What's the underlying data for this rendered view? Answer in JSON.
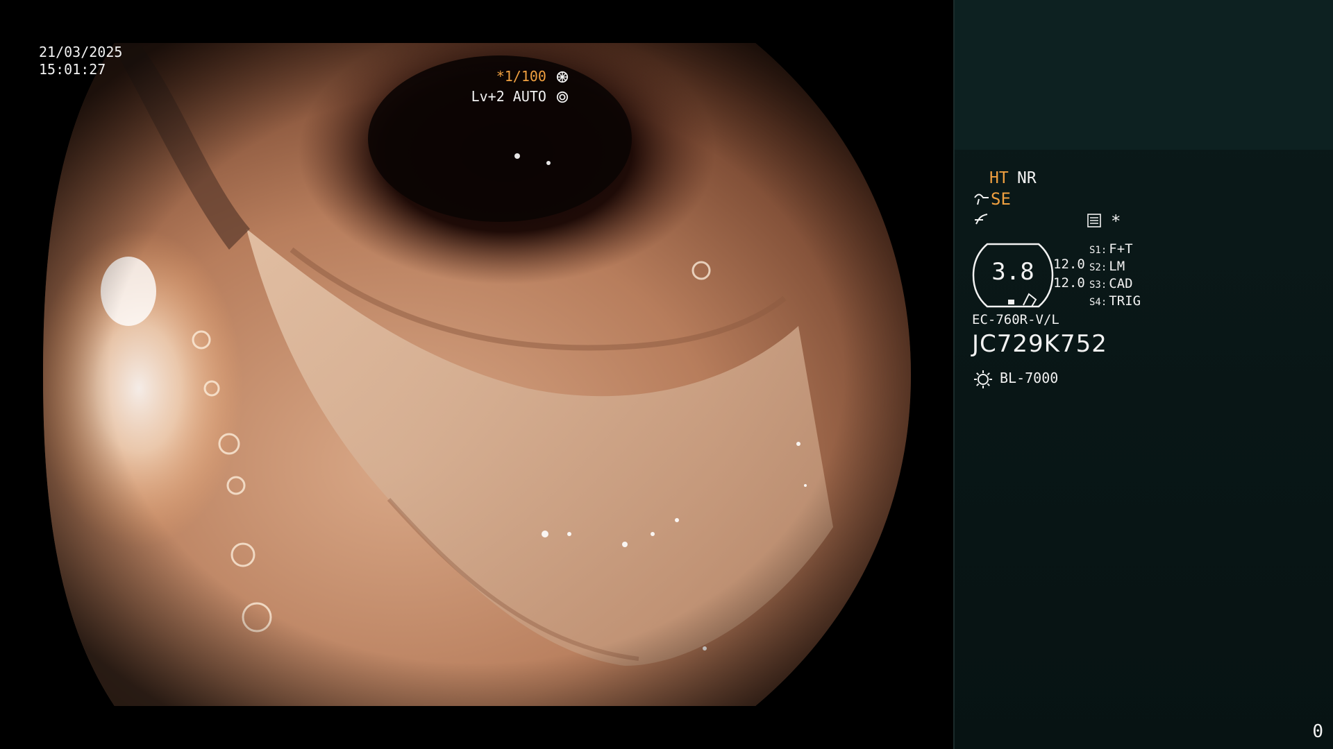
{
  "view": {
    "date": "21/03/2025",
    "time": "15:01:27",
    "shutter": "*1/100",
    "shutter_icon": "shutter-icon",
    "level": "Lv+2 AUTO",
    "level_icon": "auto-iris-icon"
  },
  "panel": {
    "ht": "HT",
    "nr": "NR",
    "se": "SE",
    "se_icon": "structure-enhancement-icon",
    "enh_icon": "contrast-icon",
    "menu_icon": "menu-icon",
    "star": "*",
    "gauge_value": "3.8",
    "value1": "12.0",
    "value2": "12.0",
    "switches": [
      {
        "key": "S1:",
        "value": "F+T"
      },
      {
        "key": "S2:",
        "value": "LM"
      },
      {
        "key": "S3:",
        "value": "CAD"
      },
      {
        "key": "S4:",
        "value": "TRIG"
      }
    ],
    "scope_model": "EC-760R-V/L",
    "serial": "JC729K752",
    "light_icon": "light-source-icon",
    "light_source": "BL-7000",
    "counter": "0"
  },
  "colors": {
    "accent_orange": "#f0a040",
    "panel_bg": "#0b1a1a",
    "panel_top": "#0d2121"
  }
}
